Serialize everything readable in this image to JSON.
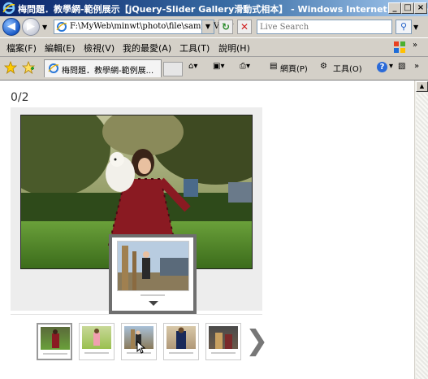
{
  "window": {
    "title": "梅問題．教學網-範例展示【jQuery-Slider Gallery滑動式相本】 - Windows Internet Explorer",
    "controls": {
      "minimize": "_",
      "maximize": "□",
      "close": "×"
    }
  },
  "address_bar": {
    "url": "F:\\MyWeb\\minwt\\photo\\file\\sampleView",
    "search_placeholder": "Live Search"
  },
  "menu": {
    "items": [
      {
        "label": "檔案(F)"
      },
      {
        "label": "編輯(E)"
      },
      {
        "label": "檢視(V)"
      },
      {
        "label": "我的最愛(A)"
      },
      {
        "label": "工具(T)"
      },
      {
        "label": "說明(H)"
      }
    ],
    "more": "»"
  },
  "favorites_bar": {
    "tab_title": "梅問題．教學網-範例展...",
    "commands": {
      "page": "網頁(P)",
      "tools": "工具(O)",
      "help": "?"
    },
    "more": "»"
  },
  "gallery": {
    "counter": "0/2",
    "thumbnail_count": 5,
    "selected_index": 0,
    "hover_index": 2,
    "next_glyph": "❯"
  },
  "colors": {
    "titlebar_start": "#0a246a",
    "titlebar_end": "#a6caf0",
    "chrome": "#d4d0c8",
    "gallery_bg": "#ededed",
    "popup_border": "#6f6f6f"
  }
}
